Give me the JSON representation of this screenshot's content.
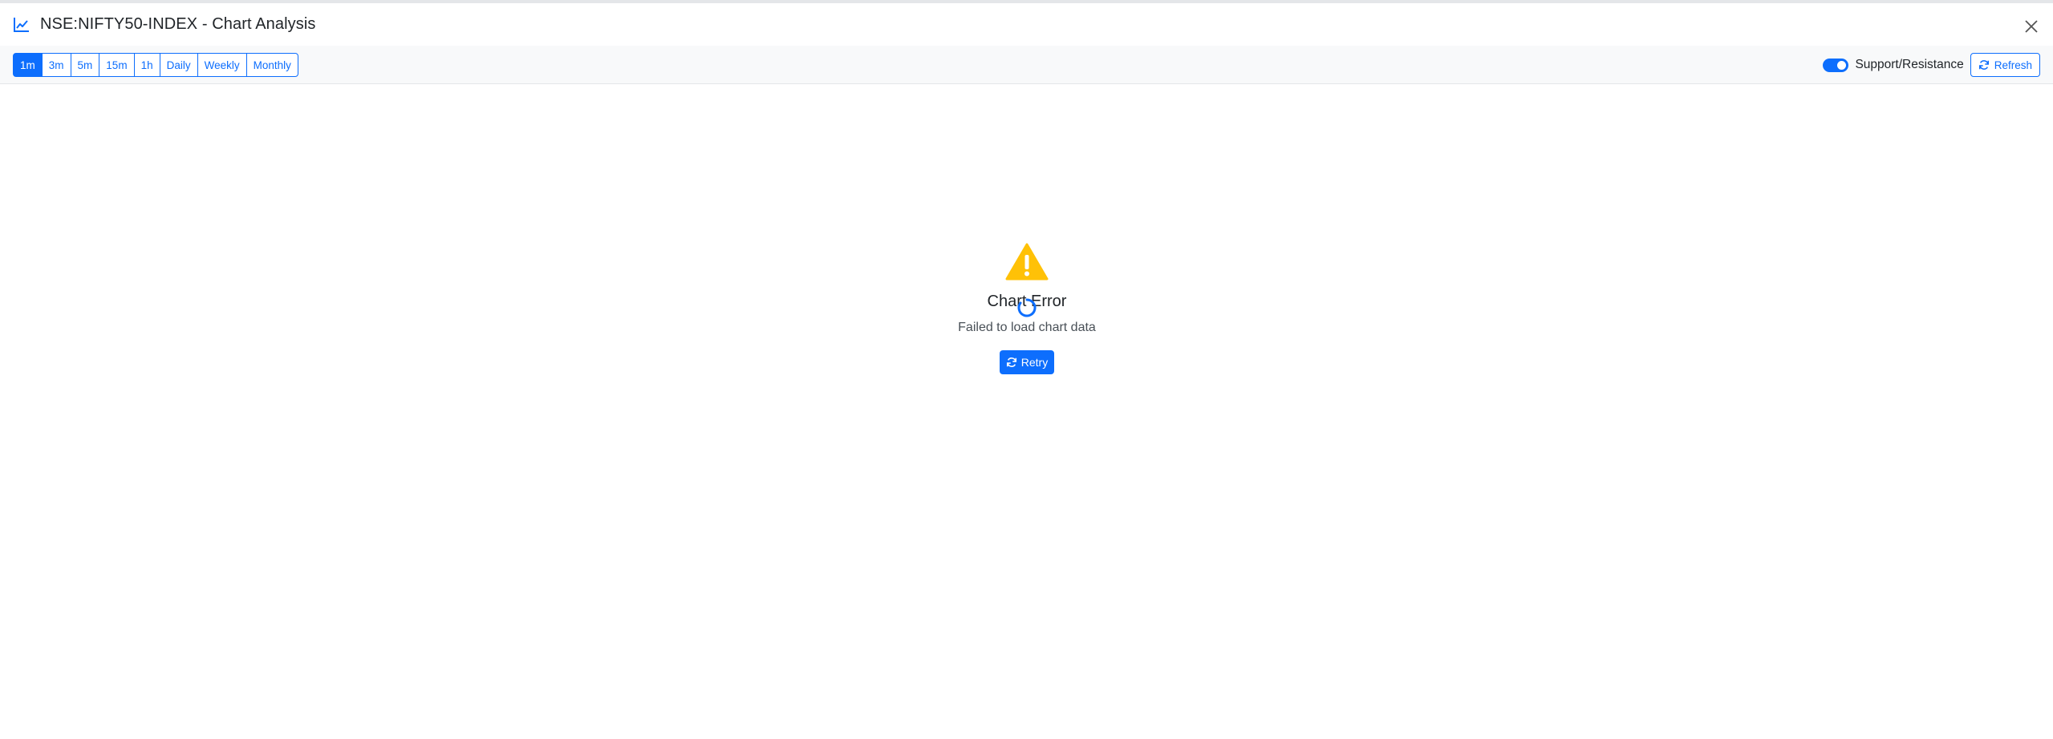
{
  "header": {
    "title": "NSE:NIFTY50-INDEX - Chart Analysis",
    "title_icon": "line-chart-icon",
    "close_icon": "close-icon"
  },
  "toolbar": {
    "timeframes": [
      {
        "label": "1m",
        "active": true
      },
      {
        "label": "3m",
        "active": false
      },
      {
        "label": "5m",
        "active": false
      },
      {
        "label": "15m",
        "active": false
      },
      {
        "label": "1h",
        "active": false
      },
      {
        "label": "Daily",
        "active": false
      },
      {
        "label": "Weekly",
        "active": false
      },
      {
        "label": "Monthly",
        "active": false
      }
    ],
    "support_resistance": {
      "label": "Support/Resistance",
      "enabled": true
    },
    "refresh_label": "Refresh",
    "refresh_icon": "refresh-icon"
  },
  "error": {
    "icon": "warning-icon",
    "title": "Chart Error",
    "message": "Failed to load chart data",
    "retry_label": "Retry",
    "spinner_icon": "loading-spinner-icon"
  },
  "colors": {
    "accent": "#0d6efd",
    "warning": "#ffc107",
    "toolbar_bg": "#f8f9fa"
  }
}
